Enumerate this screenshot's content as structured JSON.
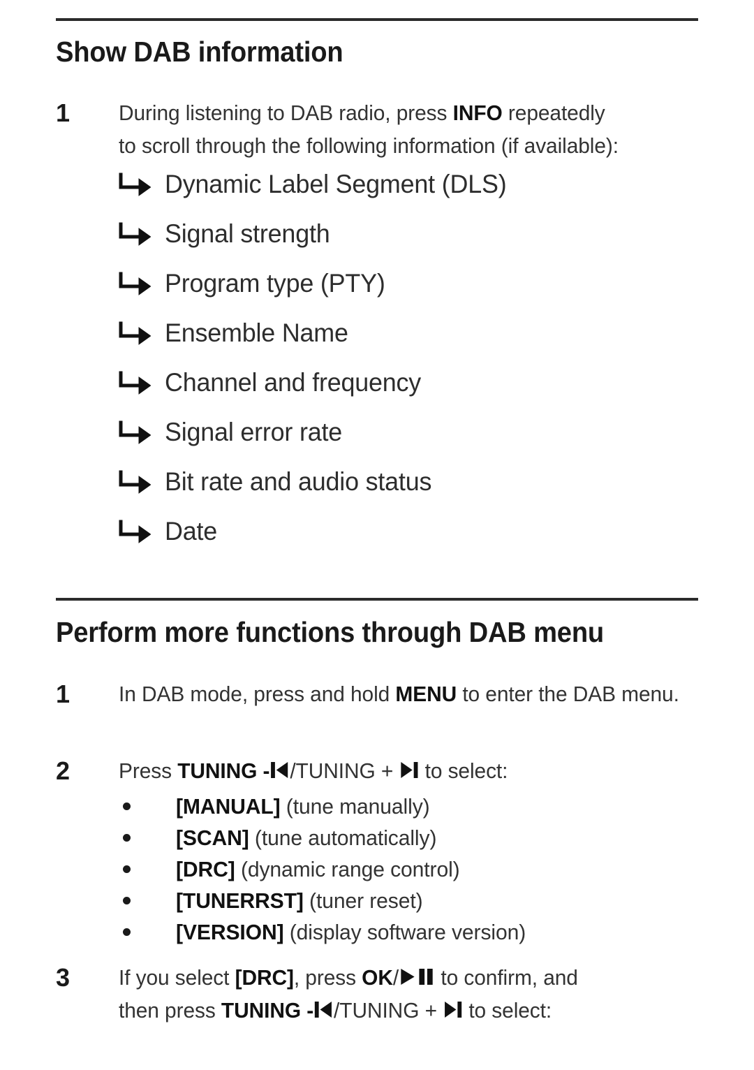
{
  "page": {
    "background": "#ffffff",
    "text_color": "#231f20",
    "rule_color": "#2b2b2b"
  },
  "sections": [
    {
      "heading": "Show DAB information",
      "steps": [
        {
          "number": "1",
          "line1_pre": "During listening to DAB radio, press ",
          "line1_bold": "INFO",
          "line1_post": " repeatedly",
          "line2": "to scroll through the following information (if available):"
        }
      ],
      "arrow_items": [
        {
          "icon": "arrow-turn-right-icon",
          "label": "Dynamic Label Segment (DLS)"
        },
        {
          "icon": "arrow-turn-right-icon",
          "label": "Signal strength"
        },
        {
          "icon": "arrow-turn-right-icon",
          "label": "Program type (PTY)"
        },
        {
          "icon": "arrow-turn-right-icon",
          "label": "Ensemble Name"
        },
        {
          "icon": "arrow-turn-right-icon",
          "label": "Channel and frequency"
        },
        {
          "icon": "arrow-turn-right-icon",
          "label": "Signal error rate"
        },
        {
          "icon": "arrow-turn-right-icon",
          "label": "Bit rate and audio status"
        },
        {
          "icon": "arrow-turn-right-icon",
          "label": "Date"
        }
      ]
    },
    {
      "heading": "Perform more functions through DAB menu",
      "steps": [
        {
          "number": "1",
          "pre": "In DAB mode, press and hold ",
          "bold": "MENU",
          "post": " to enter the DAB menu."
        },
        {
          "number": "2",
          "pre": "Press ",
          "bold_tuning_minus": "TUNING -",
          "icon_prev": "skip-previous-icon",
          "mid": "/TUNING + ",
          "icon_next": "skip-next-icon",
          "post": " to select:"
        },
        {
          "number": "3",
          "line1_pre": "If you select ",
          "line1_drc": "[DRC]",
          "line1_mid": ", press ",
          "line1_ok": "OK",
          "line1_slash": "/",
          "icon_play": "play-icon",
          "icon_pause": "pause-icon",
          "line1_post": " to confirm, and",
          "line2_pre": "then press ",
          "line2_bold": "TUNING -",
          "icon_prev": "skip-previous-icon",
          "line2_mid": "/TUNING + ",
          "icon_next": "skip-next-icon",
          "line2_post": " to select:"
        }
      ],
      "menu_options": [
        {
          "code": "[MANUAL]",
          "desc": " (tune manually)"
        },
        {
          "code": "[SCAN]",
          "desc": " (tune automatically)"
        },
        {
          "code": "[DRC]",
          "desc": " (dynamic range control)"
        },
        {
          "code": "[TUNERRST]",
          "desc": " (tuner reset)"
        },
        {
          "code": "[VERSION]",
          "desc": " (display software version)"
        }
      ]
    }
  ]
}
